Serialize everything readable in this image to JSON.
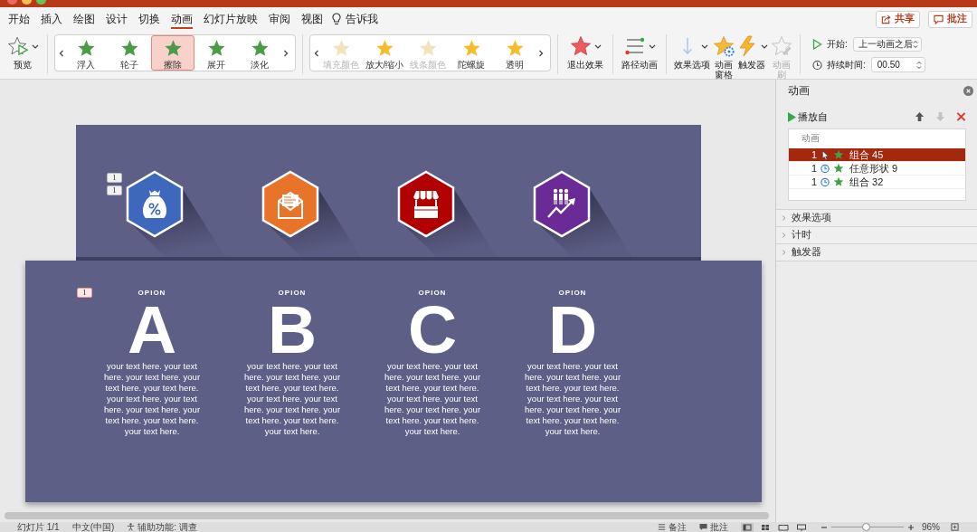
{
  "ribbon_tabs": [
    {
      "label": "开始",
      "selected": false
    },
    {
      "label": "插入",
      "selected": false
    },
    {
      "label": "绘图",
      "selected": false
    },
    {
      "label": "设计",
      "selected": false
    },
    {
      "label": "切换",
      "selected": false
    },
    {
      "label": "动画",
      "selected": true
    },
    {
      "label": "幻灯片放映",
      "selected": false
    },
    {
      "label": "审阅",
      "selected": false
    },
    {
      "label": "视图",
      "selected": false
    }
  ],
  "tell_me": {
    "label": "告诉我"
  },
  "header_buttons": [
    {
      "kind": "share",
      "label": "共享"
    },
    {
      "kind": "comments",
      "label": "批注"
    }
  ],
  "preview_button": {
    "label": "预览"
  },
  "effect_galleries": [
    {
      "kind": "entrance",
      "items": [
        {
          "label": "浮入",
          "selected": false,
          "disabled": false
        },
        {
          "label": "轮子",
          "selected": false,
          "disabled": false
        },
        {
          "label": "擦除",
          "selected": true,
          "disabled": false
        },
        {
          "label": "展开",
          "selected": false,
          "disabled": false
        },
        {
          "label": "淡化",
          "selected": false,
          "disabled": false
        }
      ]
    },
    {
      "kind": "emphasis",
      "items": [
        {
          "label": "填充颜色",
          "selected": false,
          "disabled": true
        },
        {
          "label": "放大/缩小",
          "selected": false,
          "disabled": false
        },
        {
          "label": "线条颜色",
          "selected": false,
          "disabled": true
        },
        {
          "label": "陀螺旋",
          "selected": false,
          "disabled": false
        },
        {
          "label": "透明",
          "selected": false,
          "disabled": false
        }
      ]
    }
  ],
  "ribbon_groups": [
    [
      {
        "kind": "exit",
        "label": "退出效果",
        "dropdown": true,
        "disabled": false
      }
    ],
    [
      {
        "kind": "path",
        "label": "路径动画",
        "dropdown": true,
        "disabled": false
      }
    ],
    [
      {
        "kind": "options",
        "label": "效果选项",
        "dropdown": true,
        "disabled": false
      },
      {
        "kind": "pane",
        "label": "动画窗格",
        "dropdown": false,
        "disabled": false
      },
      {
        "kind": "trigger",
        "label": "触发器",
        "dropdown": true,
        "disabled": false
      },
      {
        "kind": "painter",
        "label": "动画刷",
        "dropdown": false,
        "disabled": true
      }
    ]
  ],
  "timing": {
    "start_label": "开始:",
    "start_value": "上一动画之后",
    "duration_label": "持续时间:",
    "duration_value": "00.50"
  },
  "slide": {
    "hexagon_tags": [
      "1",
      "1"
    ],
    "hexagons": [
      {
        "kind": "money",
        "color": "#3d68bb"
      },
      {
        "kind": "mail",
        "color": "#e8742a"
      },
      {
        "kind": "shop",
        "color": "#b20000"
      },
      {
        "kind": "growth",
        "color": "#6b2b96"
      }
    ],
    "option_tag": "1",
    "options": [
      {
        "heading": "OPION",
        "letter": "A",
        "text": "your text here. your text here. your text here. your text here. your text here. your text here. your text here. your text here. your text here. your text here. your text here."
      },
      {
        "heading": "OPION",
        "letter": "B",
        "text": "your text here. your text here. your text here. your text here. your text here. your text here. your text here. your text here. your text here. your text here. your text here."
      },
      {
        "heading": "OPION",
        "letter": "C",
        "text": "your text here. your text here. your text here. your text here. your text here. your text here. your text here. your text here. your text here. your text here. your text here."
      },
      {
        "heading": "OPION",
        "letter": "D",
        "text": "your text here. your text here. your text here. your text here. your text here. your text here. your text here. your text here. your text here. your text here. your text here."
      }
    ]
  },
  "animation_pane": {
    "title": "动画",
    "play_label": "播放自",
    "tools": [
      {
        "kind": "up",
        "disabled": false
      },
      {
        "kind": "down",
        "disabled": true
      },
      {
        "kind": "delete",
        "disabled": false
      }
    ],
    "list_header": "动画",
    "items": [
      {
        "order": "1",
        "kind": "on_click",
        "name": "组合 45",
        "selected": true
      },
      {
        "order": "1",
        "kind": "after_previous",
        "name": "任意形状 9",
        "selected": false
      },
      {
        "order": "1",
        "kind": "after_previous",
        "name": "组合 32",
        "selected": false
      }
    ],
    "sections": [
      {
        "label": "效果选项",
        "expanded": false
      },
      {
        "label": "计时",
        "expanded": false
      },
      {
        "label": "触发器",
        "expanded": false
      }
    ]
  },
  "status_bar": {
    "items": [
      {
        "kind": "plain",
        "label": "幻灯片 1/1"
      },
      {
        "kind": "plain",
        "label": "中文(中国)"
      },
      {
        "kind": "accessibility",
        "label": "辅助功能: 调查"
      }
    ],
    "notes": "备注",
    "comments": "批注",
    "views": [
      {
        "kind": "normal",
        "selected": true
      },
      {
        "kind": "sorter",
        "selected": false
      },
      {
        "kind": "reading",
        "selected": false
      },
      {
        "kind": "show",
        "selected": false
      }
    ],
    "zoom": {
      "level": 0.47,
      "reading": "96%"
    }
  }
}
